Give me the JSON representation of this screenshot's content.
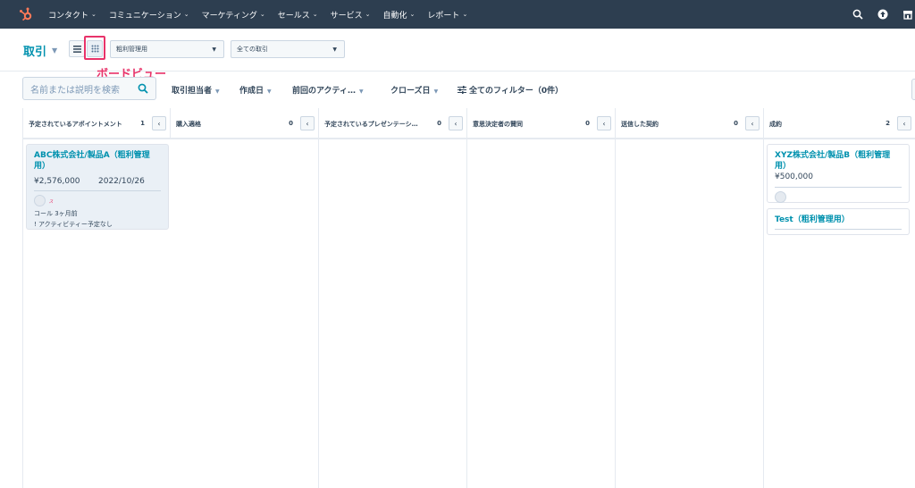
{
  "nav": {
    "items": [
      "コンタクト",
      "コミュニケーション",
      "マーケティング",
      "セールス",
      "サービス",
      "自動化",
      "レポート"
    ]
  },
  "header": {
    "title": "取引",
    "pipeline_select": "粗利管理用",
    "deals_select": "全ての取引",
    "annotation": "ボードビュー"
  },
  "filters": {
    "search_placeholder": "名前または説明を検索",
    "items": [
      "取引担当者",
      "作成日",
      "前回のアクティ…",
      "クローズ日",
      "全てのフィルター（0件）"
    ]
  },
  "columns": [
    {
      "name": "予定されているアポイントメント",
      "count": "1"
    },
    {
      "name": "購入適格",
      "count": "0"
    },
    {
      "name": "予定されているプレゼンテーシ…",
      "count": "0"
    },
    {
      "name": "意思決定者の賛同",
      "count": "0"
    },
    {
      "name": "送信した契約",
      "count": "0"
    },
    {
      "name": "成約",
      "count": "2"
    }
  ],
  "cards": {
    "abc": {
      "name": "ABC株式会社/製品A（粗利管理用）",
      "amount": "¥2,576,000",
      "date": "2022/10/26",
      "activity": "コール 3ヶ月前",
      "next": "! アクティビティー予定なし"
    },
    "xyz": {
      "name": "XYZ株式会社/製品B（粗利管理用）",
      "amount": "¥500,000"
    },
    "test": {
      "name": "Test（粗利管理用）"
    }
  },
  "colors": {
    "nav_bg": "#2d3e50",
    "link": "#0091ae",
    "highlight": "#e8336a",
    "hubspot_orange": "#ff7a59"
  }
}
